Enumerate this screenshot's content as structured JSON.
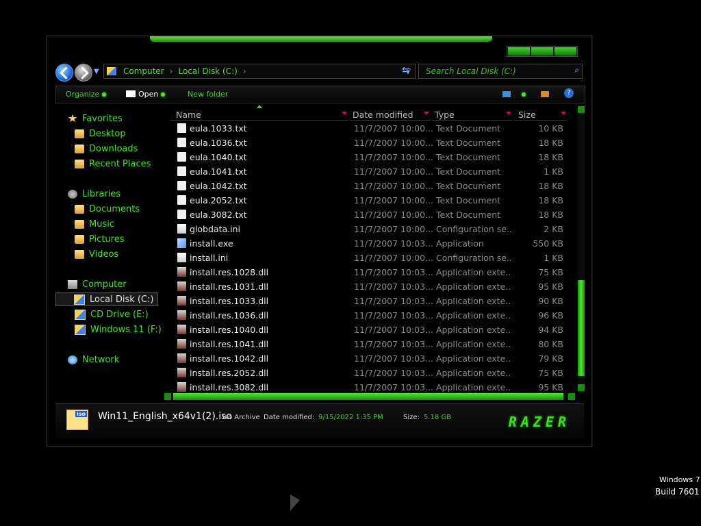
{
  "navbar": {
    "breadcrumb": [
      "Computer",
      "Local Disk (C:)"
    ],
    "search_placeholder": "Search Local Disk (C:)"
  },
  "toolbar": {
    "organize": "Organize",
    "open": "Open",
    "new_folder": "New folder"
  },
  "sidebar": {
    "favorites": "Favorites",
    "desktop": "Desktop",
    "downloads": "Downloads",
    "recent": "Recent Places",
    "libraries": "Libraries",
    "documents": "Documents",
    "music": "Music",
    "pictures": "Pictures",
    "videos": "Videos",
    "computer": "Computer",
    "local_disk": "Local Disk (C:)",
    "cd_drive": "CD Drive (E:)",
    "win11": "Windows 11 (F:)",
    "network": "Network"
  },
  "columns": {
    "name": "Name",
    "date": "Date modified",
    "type": "Type",
    "size": "Size"
  },
  "files": [
    {
      "name": "eula.1033.txt",
      "date": "11/7/2007 10:00...",
      "type": "Text Document",
      "size": "10 KB",
      "icon": "txt"
    },
    {
      "name": "eula.1036.txt",
      "date": "11/7/2007 10:00...",
      "type": "Text Document",
      "size": "18 KB",
      "icon": "txt"
    },
    {
      "name": "eula.1040.txt",
      "date": "11/7/2007 10:00...",
      "type": "Text Document",
      "size": "18 KB",
      "icon": "txt"
    },
    {
      "name": "eula.1041.txt",
      "date": "11/7/2007 10:00...",
      "type": "Text Document",
      "size": "1 KB",
      "icon": "txt"
    },
    {
      "name": "eula.1042.txt",
      "date": "11/7/2007 10:00...",
      "type": "Text Document",
      "size": "18 KB",
      "icon": "txt"
    },
    {
      "name": "eula.2052.txt",
      "date": "11/7/2007 10:00...",
      "type": "Text Document",
      "size": "18 KB",
      "icon": "txt"
    },
    {
      "name": "eula.3082.txt",
      "date": "11/7/2007 10:00...",
      "type": "Text Document",
      "size": "18 KB",
      "icon": "txt"
    },
    {
      "name": "globdata.ini",
      "date": "11/7/2007 10:00...",
      "type": "Configuration se...",
      "size": "2 KB",
      "icon": "ini"
    },
    {
      "name": "install.exe",
      "date": "11/7/2007 10:03...",
      "type": "Application",
      "size": "550 KB",
      "icon": "exe"
    },
    {
      "name": "install.ini",
      "date": "11/7/2007 10:00...",
      "type": "Configuration se...",
      "size": "1 KB",
      "icon": "ini"
    },
    {
      "name": "install.res.1028.dll",
      "date": "11/7/2007 10:03...",
      "type": "Application exte...",
      "size": "75 KB",
      "icon": "dll"
    },
    {
      "name": "install.res.1031.dll",
      "date": "11/7/2007 10:03...",
      "type": "Application exte...",
      "size": "95 KB",
      "icon": "dll"
    },
    {
      "name": "install.res.1033.dll",
      "date": "11/7/2007 10:03...",
      "type": "Application exte...",
      "size": "90 KB",
      "icon": "dll"
    },
    {
      "name": "install.res.1036.dll",
      "date": "11/7/2007 10:03...",
      "type": "Application exte...",
      "size": "96 KB",
      "icon": "dll"
    },
    {
      "name": "install.res.1040.dll",
      "date": "11/7/2007 10:03...",
      "type": "Application exte...",
      "size": "94 KB",
      "icon": "dll"
    },
    {
      "name": "install.res.1041.dll",
      "date": "11/7/2007 10:03...",
      "type": "Application exte...",
      "size": "80 KB",
      "icon": "dll"
    },
    {
      "name": "install.res.1042.dll",
      "date": "11/7/2007 10:03...",
      "type": "Application exte...",
      "size": "79 KB",
      "icon": "dll"
    },
    {
      "name": "install.res.2052.dll",
      "date": "11/7/2007 10:03...",
      "type": "Application exte...",
      "size": "75 KB",
      "icon": "dll"
    },
    {
      "name": "install.res.3082.dll",
      "date": "11/7/2007 10:03...",
      "type": "Application exte...",
      "size": "95 KB",
      "icon": "dll"
    }
  ],
  "details": {
    "icon_label": "iso",
    "file_name": "Win11_English_x64v1(2).iso",
    "file_type": "iso Archive",
    "date_label": "Date modified:",
    "date_value": "9/15/2022 1:35 PM",
    "size_label": "Size:",
    "size_value": "5.18 GB",
    "logo_text": "RAZER"
  },
  "desktop": {
    "os_name": "Windows 7",
    "build": "Build 7601"
  }
}
